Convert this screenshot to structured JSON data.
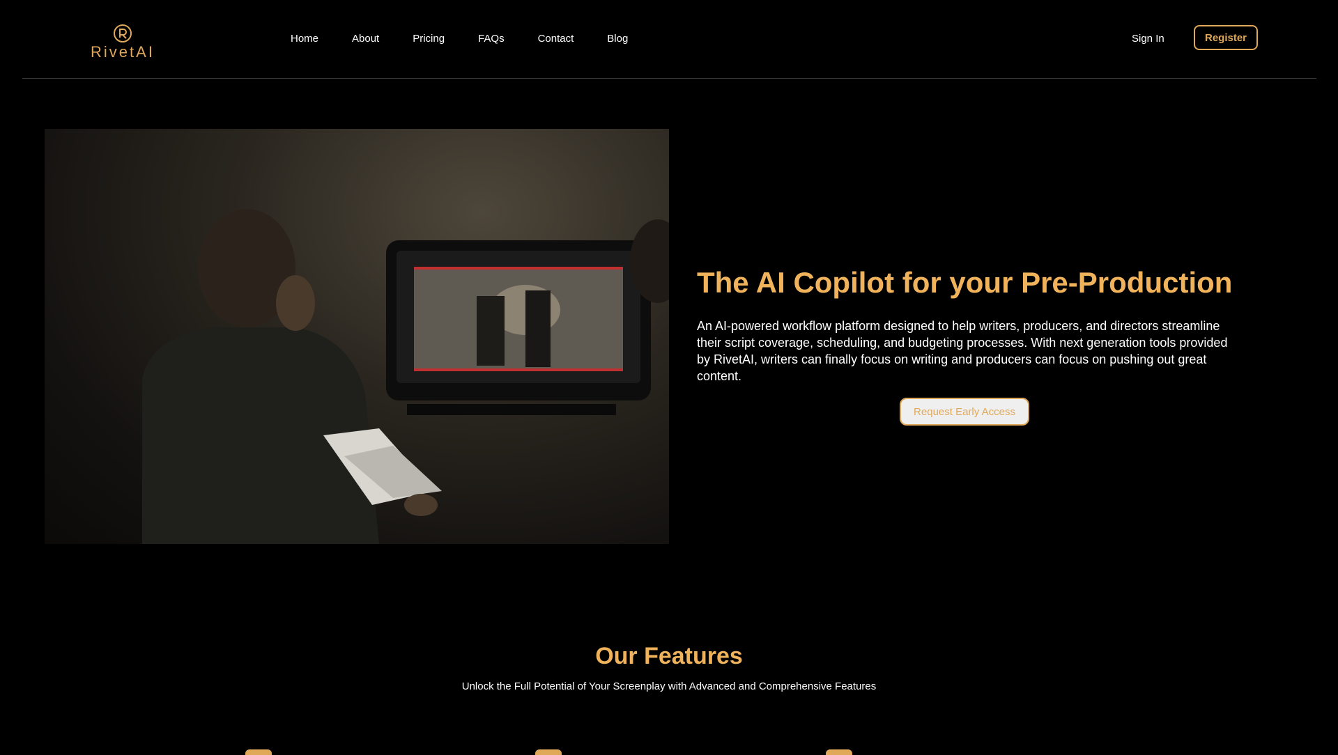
{
  "brand": {
    "name": "RivetAI",
    "accent": "#e0a95a",
    "title_color": "#f0b35c"
  },
  "nav": {
    "links": [
      "Home",
      "About",
      "Pricing",
      "FAQs",
      "Contact",
      "Blog"
    ],
    "sign_in": "Sign In",
    "register": "Register"
  },
  "hero": {
    "image_alt": "",
    "title": "The AI Copilot for your Pre-Production",
    "description": "An AI-powered workflow platform designed to help writers, producers, and directors streamline their script coverage, scheduling, and budgeting processes. With next generation tools provided by RivetAI, writers can finally focus on writing and producers can focus on pushing out great content.",
    "cta": "Request Early Access"
  },
  "features": {
    "title": "Our Features",
    "subtitle": "Unlock the Full Potential of Your Screenplay with Advanced and Comprehensive Features",
    "icons": [
      "feature-icon",
      "feature-icon",
      "feature-icon"
    ]
  }
}
